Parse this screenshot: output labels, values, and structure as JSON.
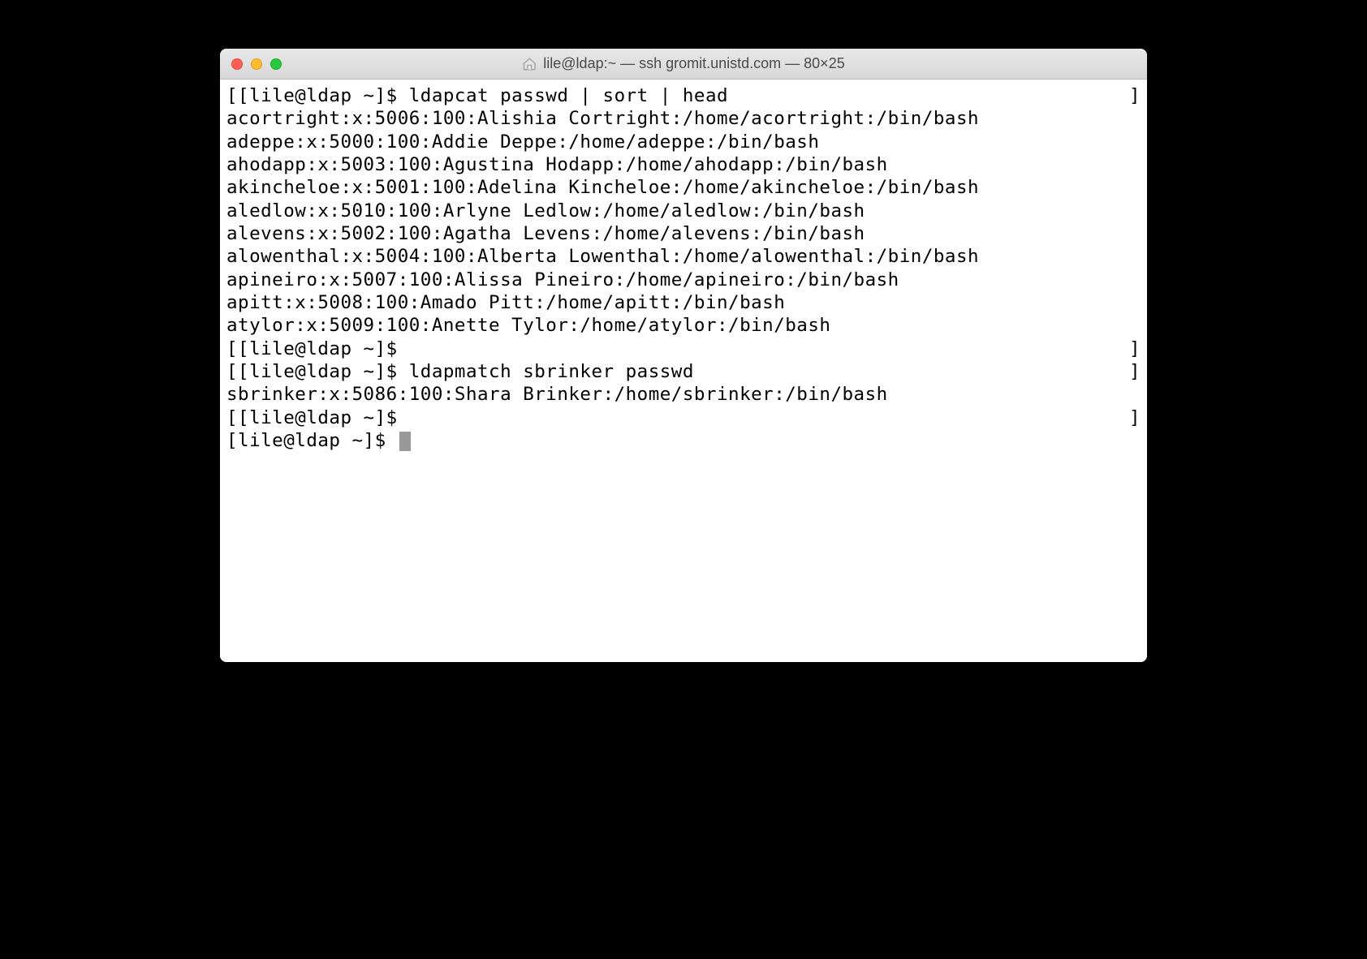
{
  "window": {
    "title": "lile@ldap:~ — ssh gromit.unistd.com — 80×25"
  },
  "terminal": {
    "prompt": "[lile@ldap ~]$",
    "lines": [
      {
        "type": "prompt",
        "text": "[lile@ldap ~]$ ldapcat passwd | sort | head",
        "bracket": true
      },
      {
        "type": "output",
        "text": "acortright:x:5006:100:Alishia Cortright:/home/acortright:/bin/bash"
      },
      {
        "type": "output",
        "text": "adeppe:x:5000:100:Addie Deppe:/home/adeppe:/bin/bash"
      },
      {
        "type": "output",
        "text": "ahodapp:x:5003:100:Agustina Hodapp:/home/ahodapp:/bin/bash"
      },
      {
        "type": "output",
        "text": "akincheloe:x:5001:100:Adelina Kincheloe:/home/akincheloe:/bin/bash"
      },
      {
        "type": "output",
        "text": "aledlow:x:5010:100:Arlyne Ledlow:/home/aledlow:/bin/bash"
      },
      {
        "type": "output",
        "text": "alevens:x:5002:100:Agatha Levens:/home/alevens:/bin/bash"
      },
      {
        "type": "output",
        "text": "alowenthal:x:5004:100:Alberta Lowenthal:/home/alowenthal:/bin/bash"
      },
      {
        "type": "output",
        "text": "apineiro:x:5007:100:Alissa Pineiro:/home/apineiro:/bin/bash"
      },
      {
        "type": "output",
        "text": "apitt:x:5008:100:Amado Pitt:/home/apitt:/bin/bash"
      },
      {
        "type": "output",
        "text": "atylor:x:5009:100:Anette Tylor:/home/atylor:/bin/bash"
      },
      {
        "type": "prompt",
        "text": "[lile@ldap ~]$",
        "bracket": true
      },
      {
        "type": "prompt",
        "text": "[lile@ldap ~]$ ldapmatch sbrinker passwd",
        "bracket": true
      },
      {
        "type": "output",
        "text": "sbrinker:x:5086:100:Shara Brinker:/home/sbrinker:/bin/bash"
      },
      {
        "type": "prompt",
        "text": "[lile@ldap ~]$",
        "bracket": true
      },
      {
        "type": "prompt-cursor",
        "text": "[lile@ldap ~]$ "
      }
    ]
  }
}
